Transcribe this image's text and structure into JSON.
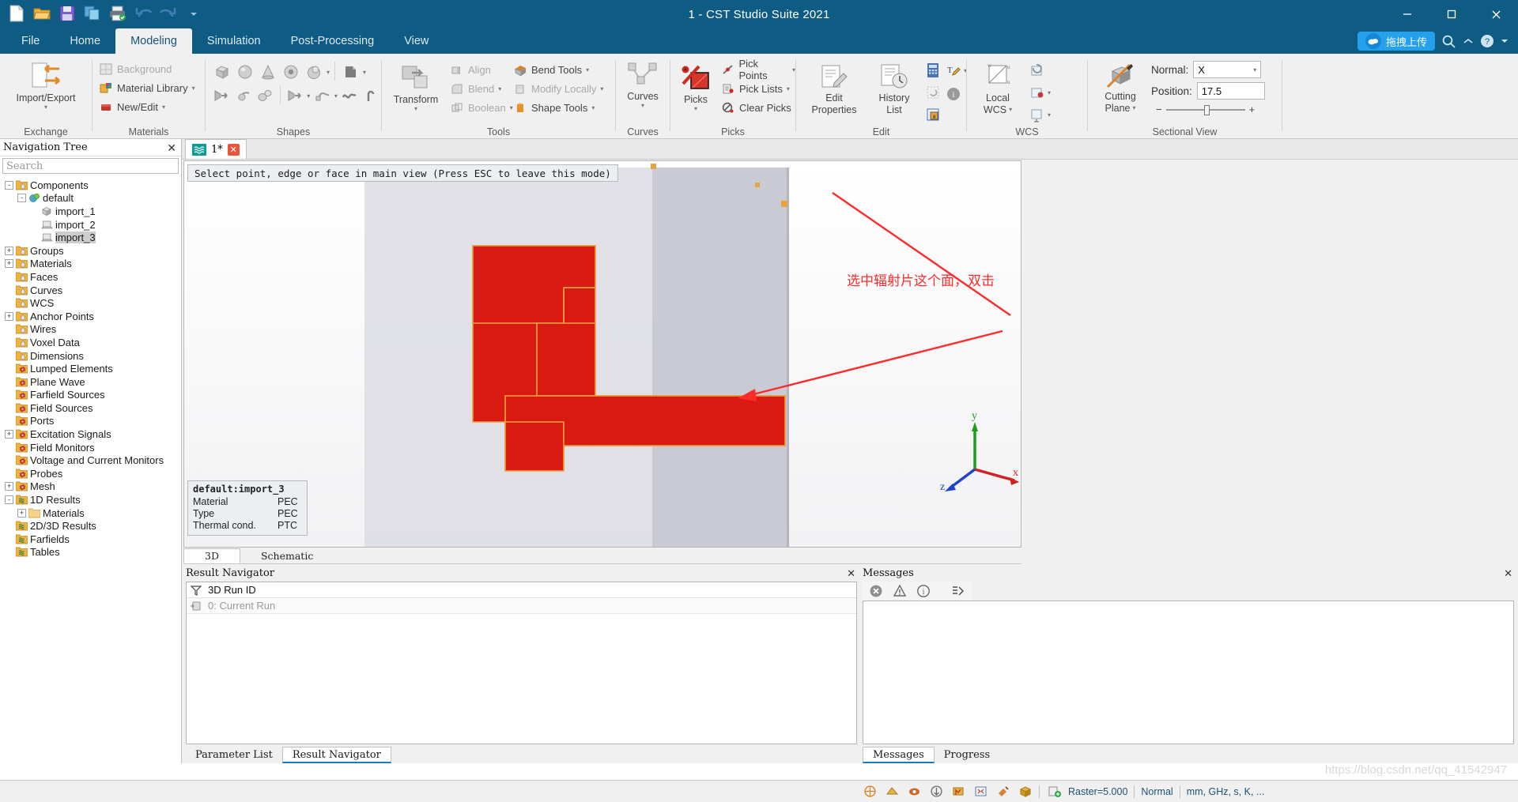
{
  "window": {
    "title": "1 - CST Studio Suite 2021",
    "minimize": "─",
    "maximize": "☐",
    "close": "✕"
  },
  "quick_access": [
    {
      "name": "new-icon",
      "label": "New"
    },
    {
      "name": "open-icon",
      "label": "Open"
    },
    {
      "name": "save-icon",
      "label": "Save"
    },
    {
      "name": "copy-icon",
      "label": "Copy"
    },
    {
      "name": "print-icon",
      "label": "Print"
    },
    {
      "name": "undo-icon",
      "label": "Undo"
    },
    {
      "name": "redo-icon",
      "label": "Redo"
    },
    {
      "name": "customize-qat-icon",
      "label": "Customize Quick Access Toolbar"
    }
  ],
  "menu": {
    "tabs": [
      {
        "label": "File",
        "active": false
      },
      {
        "label": "Home",
        "active": false
      },
      {
        "label": "Modeling",
        "active": true
      },
      {
        "label": "Simulation",
        "active": false
      },
      {
        "label": "Post-Processing",
        "active": false
      },
      {
        "label": "View",
        "active": false
      }
    ],
    "upload_pill": "拖拽上传",
    "search_icon": "search-icon",
    "help_icon": "help-icon",
    "chevron_icon": "chevron-up-icon"
  },
  "ribbon": {
    "groups": [
      {
        "label": "Exchange"
      },
      {
        "label": "Materials"
      },
      {
        "label": "Shapes"
      },
      {
        "label": "Tools"
      },
      {
        "label": "Curves"
      },
      {
        "label": "Picks"
      },
      {
        "label": "Edit"
      },
      {
        "label": "WCS"
      },
      {
        "label": "Sectional View"
      }
    ],
    "exchange": {
      "import_export": "Import/Export"
    },
    "materials": {
      "background": "Background",
      "material_library": "Material Library",
      "new_edit": "New/Edit"
    },
    "tools": {
      "transform": "Transform",
      "align": "Align",
      "blend": "Blend",
      "boolean": "Boolean",
      "bend_tools": "Bend Tools",
      "modify_locally": "Modify Locally",
      "shape_tools": "Shape Tools"
    },
    "curves": {
      "curves": "Curves"
    },
    "picks": {
      "picks": "Picks",
      "pick_points": "Pick Points",
      "pick_lists": "Pick Lists",
      "clear_picks": "Clear Picks"
    },
    "edit": {
      "edit_properties_line1": "Edit",
      "edit_properties_line2": "Properties",
      "history_line1": "History",
      "history_line2": "List",
      "calculator_icon": "calculator-icon",
      "refresh_icon": "refresh-icon",
      "parameter_icon": "parameter-icon",
      "rename_icon": "rename-icon",
      "info_icon": "info-icon"
    },
    "wcs": {
      "local_line1": "Local",
      "local_line2": "WCS"
    },
    "sectional_view": {
      "cutting_line1": "Cutting",
      "cutting_line2": "Plane",
      "normal_label": "Normal:",
      "normal_value": "X",
      "position_label": "Position:",
      "position_value": "17.5",
      "slider_minus": "−",
      "slider_plus": "+"
    }
  },
  "navigation": {
    "title": "Navigation Tree",
    "search_placeholder": "Search",
    "close_icon": "✕",
    "tree": [
      {
        "label": "Components",
        "indent": 0,
        "expander": "-",
        "icon": "folder-drop",
        "selected": false
      },
      {
        "label": "default",
        "indent": 1,
        "expander": "-",
        "icon": "component",
        "selected": false
      },
      {
        "label": "import_1",
        "indent": 2,
        "expander": "",
        "icon": "solid",
        "selected": false
      },
      {
        "label": "import_2",
        "indent": 2,
        "expander": "",
        "icon": "sheet",
        "selected": false
      },
      {
        "label": "import_3",
        "indent": 2,
        "expander": "",
        "icon": "sheet",
        "selected": true
      },
      {
        "label": "Groups",
        "indent": 0,
        "expander": "+",
        "icon": "folder-drop",
        "selected": false
      },
      {
        "label": "Materials",
        "indent": 0,
        "expander": "+",
        "icon": "folder-drop",
        "selected": false
      },
      {
        "label": "Faces",
        "indent": 0,
        "expander": "",
        "icon": "folder-drop",
        "selected": false
      },
      {
        "label": "Curves",
        "indent": 0,
        "expander": "",
        "icon": "folder-drop",
        "selected": false
      },
      {
        "label": "WCS",
        "indent": 0,
        "expander": "",
        "icon": "folder-drop",
        "selected": false
      },
      {
        "label": "Anchor Points",
        "indent": 0,
        "expander": "+",
        "icon": "folder-drop",
        "selected": false
      },
      {
        "label": "Wires",
        "indent": 0,
        "expander": "",
        "icon": "folder-drop",
        "selected": false
      },
      {
        "label": "Voxel Data",
        "indent": 0,
        "expander": "",
        "icon": "folder-drop",
        "selected": false
      },
      {
        "label": "Dimensions",
        "indent": 0,
        "expander": "",
        "icon": "folder-drop",
        "selected": false
      },
      {
        "label": "Lumped Elements",
        "indent": 0,
        "expander": "",
        "icon": "folder-gear",
        "selected": false
      },
      {
        "label": "Plane Wave",
        "indent": 0,
        "expander": "",
        "icon": "folder-gear",
        "selected": false
      },
      {
        "label": "Farfield Sources",
        "indent": 0,
        "expander": "",
        "icon": "folder-gear",
        "selected": false
      },
      {
        "label": "Field Sources",
        "indent": 0,
        "expander": "",
        "icon": "folder-gear",
        "selected": false
      },
      {
        "label": "Ports",
        "indent": 0,
        "expander": "",
        "icon": "folder-gear",
        "selected": false
      },
      {
        "label": "Excitation Signals",
        "indent": 0,
        "expander": "+",
        "icon": "folder-gear",
        "selected": false
      },
      {
        "label": "Field Monitors",
        "indent": 0,
        "expander": "",
        "icon": "folder-gear",
        "selected": false
      },
      {
        "label": "Voltage and Current Monitors",
        "indent": 0,
        "expander": "",
        "icon": "folder-gear",
        "selected": false
      },
      {
        "label": "Probes",
        "indent": 0,
        "expander": "",
        "icon": "folder-gear",
        "selected": false
      },
      {
        "label": "Mesh",
        "indent": 0,
        "expander": "+",
        "icon": "folder-gear",
        "selected": false
      },
      {
        "label": "1D Results",
        "indent": 0,
        "expander": "-",
        "icon": "folder-results",
        "selected": false
      },
      {
        "label": "Materials",
        "indent": 1,
        "expander": "+",
        "icon": "folder-plain",
        "selected": false
      },
      {
        "label": "2D/3D Results",
        "indent": 0,
        "expander": "",
        "icon": "folder-results",
        "selected": false
      },
      {
        "label": "Farfields",
        "indent": 0,
        "expander": "",
        "icon": "folder-results",
        "selected": false
      },
      {
        "label": "Tables",
        "indent": 0,
        "expander": "",
        "icon": "folder-results",
        "selected": false
      }
    ]
  },
  "document_tab": {
    "label": "1*",
    "wave_icon": "wave-icon",
    "close_icon": "✕"
  },
  "viewport": {
    "hint": "Select point, edge or face in main view (Press ESC to leave this mode)",
    "info_box": {
      "title": "default:import_3",
      "rows": [
        {
          "key": "Material",
          "value": "PEC"
        },
        {
          "key": "Type",
          "value": "PEC"
        },
        {
          "key": "Thermal cond.",
          "value": "PTC"
        }
      ]
    },
    "annotation": "选中辐射片这个面，双击",
    "axis": {
      "x": "x",
      "y": "y",
      "z": "z"
    },
    "tabs": [
      {
        "label": "3D",
        "active": true
      },
      {
        "label": "Schematic",
        "active": false
      }
    ],
    "colors": {
      "patch": "#d91a13",
      "patch_edge": "#e8a33d",
      "substrate": "#b9b9c4",
      "annotation": "#ff2b2b"
    }
  },
  "result_navigator": {
    "title": "Result Navigator",
    "close_icon": "✕",
    "filter_icon": "filter-icon",
    "header": "3D Run ID",
    "rows": [
      {
        "icon": "run-icon",
        "label": "0: Current Run"
      }
    ],
    "tabs": [
      {
        "label": "Parameter List",
        "active": false
      },
      {
        "label": "Result Navigator",
        "active": true
      }
    ]
  },
  "messages": {
    "title": "Messages",
    "close_icon": "✕",
    "toolbar": [
      {
        "name": "error-filter-icon",
        "label": "Errors"
      },
      {
        "name": "warning-filter-icon",
        "label": "Warnings"
      },
      {
        "name": "info-filter-icon",
        "label": "Information"
      },
      {
        "name": "clear-messages-icon",
        "label": "Clear"
      }
    ],
    "tabs": [
      {
        "label": "Messages",
        "active": true
      },
      {
        "label": "Progress",
        "active": false
      }
    ]
  },
  "statusbar": {
    "raster": "Raster=5.000",
    "mode": "Normal",
    "units": "mm, GHz, s, K, ...",
    "icons": [
      "snap-icon",
      "workplane-icon",
      "view-icon",
      "axis-icon",
      "grid-icon",
      "fit-icon",
      "paint-icon",
      "box-icon",
      "add-icon"
    ]
  },
  "watermark": "https://blog.csdn.net/qq_41542947"
}
